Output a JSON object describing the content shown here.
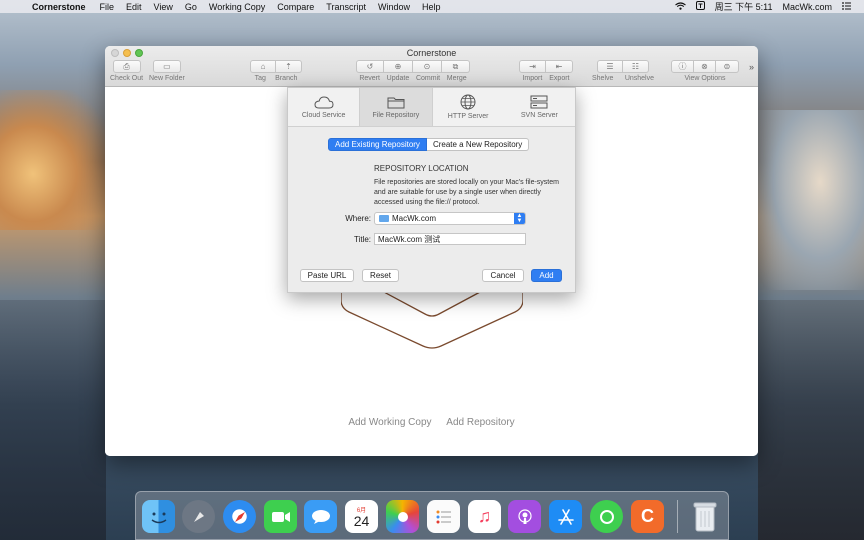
{
  "menubar": {
    "app_name": "Cornerstone",
    "items": [
      "File",
      "Edit",
      "View",
      "Go",
      "Working Copy",
      "Compare",
      "Transcript",
      "Window",
      "Help"
    ],
    "clock": "周三 下午 5:11",
    "user": "MacWk.com"
  },
  "window": {
    "title": "Cornerstone",
    "toolbar": {
      "check_out": "Check Out",
      "new_folder": "New Folder",
      "tag": "Tag",
      "branch": "Branch",
      "revert": "Revert",
      "update": "Update",
      "commit": "Commit",
      "merge": "Merge",
      "import": "Import",
      "export": "Export",
      "shelve": "Shelve",
      "unshelve": "Unshelve",
      "view_options": "View Options"
    },
    "add_working_copy": "Add Working Copy",
    "add_repository": "Add Repository"
  },
  "sheet": {
    "tabs": [
      "Cloud Service",
      "File Repository",
      "HTTP Server",
      "SVN Server"
    ],
    "active_tab": "File Repository",
    "segment_add_existing": "Add Existing Repository",
    "segment_create_new": "Create a New Repository",
    "location_heading": "REPOSITORY LOCATION",
    "location_description": "File repositories are stored locally on your Mac's file-system and are suitable for use by a single user when directly accessed using the file:// protocol.",
    "where_label": "Where:",
    "where_value": "MacWk.com",
    "title_label": "Title:",
    "title_value": "MacWk.com 测试",
    "paste_url": "Paste URL",
    "reset": "Reset",
    "cancel": "Cancel",
    "add": "Add"
  },
  "dock": {
    "calendar_month": "6月",
    "calendar_day": "24",
    "apps": [
      "finder-icon",
      "launchpad-icon",
      "safari-icon",
      "facetime-icon",
      "messages-icon",
      "calendar-icon",
      "photos-icon",
      "reminders-icon",
      "music-icon",
      "podcasts-icon",
      "app-store-icon",
      "find-my-icon",
      "cornerstone-icon",
      "trash-icon"
    ]
  },
  "colors": {
    "accent": "#2f7ef2",
    "folder": "#62a7ec"
  }
}
